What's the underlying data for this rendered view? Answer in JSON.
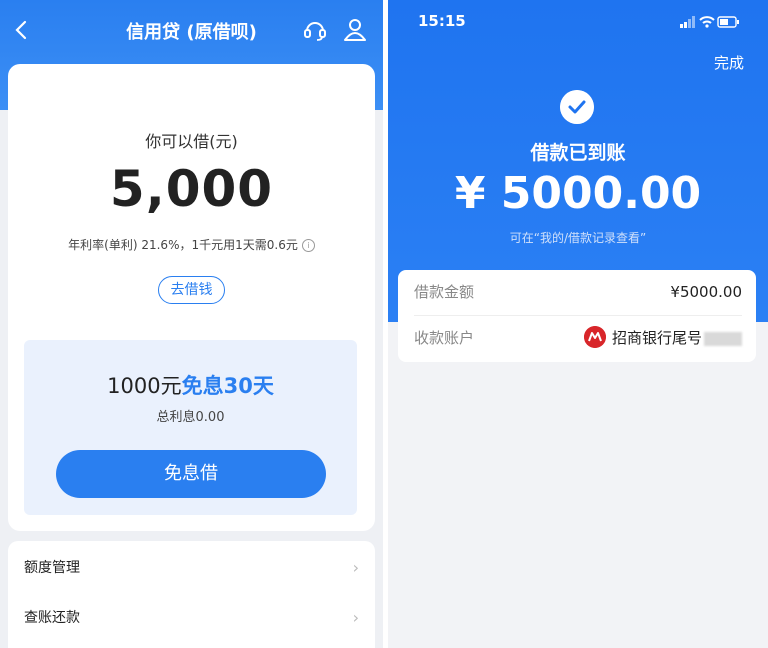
{
  "left": {
    "title": "信用贷 (原借呗)",
    "can_borrow_label": "你可以借(元)",
    "amount": "5,000",
    "rate_text": "年利率(单利) 21.6%，1千元用1天需0.6元",
    "info_icon_text": "i",
    "go_borrow_label": "去借钱",
    "promo": {
      "title_prefix": "1000元",
      "title_highlight": "免息30天",
      "total_interest": "总利息0.00",
      "button_label": "免息借"
    },
    "menu": [
      {
        "label": "额度管理"
      },
      {
        "label": "查账还款"
      }
    ],
    "colors": {
      "brand": "#2a7ff0"
    }
  },
  "right": {
    "status_time": "15:15",
    "done_label": "完成",
    "arrived_label": "借款已到账",
    "amount": "¥ 5000.00",
    "hint": "可在“我的/借款记录查看”",
    "details": [
      {
        "key": "借款金额",
        "value": "¥5000.00"
      },
      {
        "key": "收款账户",
        "value": "招商银行尾号"
      }
    ],
    "colors": {
      "brand": "#1f74f0",
      "bank": "#d8262a"
    }
  }
}
